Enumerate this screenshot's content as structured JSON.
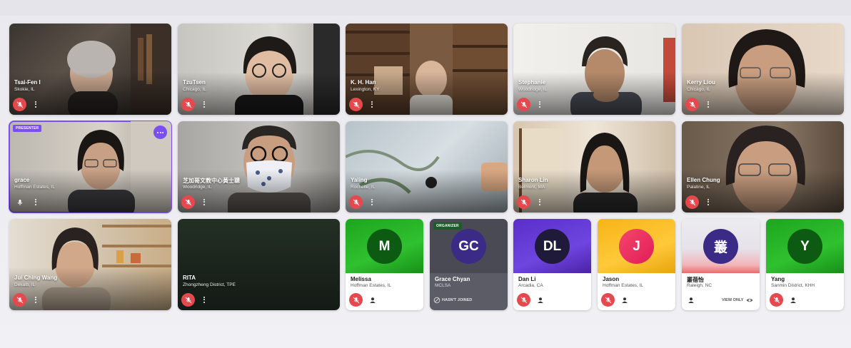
{
  "meeting": {
    "participants": [
      {
        "name": "Tsai-Fen I",
        "location": "Skokie, IL",
        "muted": true
      },
      {
        "name": "TzuTsen",
        "location": "Chicago, IL",
        "muted": true
      },
      {
        "name": "K. H. Han",
        "location": "Lexington, KY",
        "muted": true
      },
      {
        "name": "Stephanie",
        "location": "Woodridge, IL",
        "muted": true
      },
      {
        "name": "Kerry Liou",
        "location": "Chicago, IL",
        "muted": true
      },
      {
        "name": "grace",
        "location": "Hoffman Estates, IL",
        "muted": false,
        "badge": "PRESENTER"
      },
      {
        "name": "芝加哥文教中心黃士聰",
        "location": "Woodridge, IL",
        "muted": true
      },
      {
        "name": "Yaling",
        "location": "Rochelle, IL",
        "muted": true
      },
      {
        "name": "Sharon Lin",
        "location": "Belmont, MA",
        "muted": true
      },
      {
        "name": "Ellen Chung",
        "location": "Palatine, IL",
        "muted": true
      },
      {
        "name": "Jui Ching Wang",
        "location": "Dekalb, IL",
        "muted": true
      },
      {
        "name": "RITA",
        "location": "Zhongzheng District, TPE",
        "muted": true
      },
      {
        "name": "Melissa",
        "location": "Hoffman Estates, IL",
        "initials": "M",
        "muted": true
      },
      {
        "name": "Grace Chyan",
        "location": "MCLSA",
        "initials": "GC",
        "badge": "ORGANIZER",
        "status": "HASN'T JOINED"
      },
      {
        "name": "Dan Li",
        "location": "Arcadia, CA",
        "initials": "DL",
        "muted": true
      },
      {
        "name": "Jason",
        "location": "Hoffman Estates, IL",
        "initials": "J",
        "muted": true
      },
      {
        "name": "叢蓓怡",
        "location": "Raleigh, NC",
        "initials": "叢",
        "status": "VIEW ONLY"
      },
      {
        "name": "Yang",
        "location": "Sanmin District, KHH",
        "initials": "Y",
        "muted": true
      }
    ]
  },
  "colors": {
    "mute_red": "#e5484d",
    "presenter_purple": "#7a4ef0",
    "organizer_green": "#1e5a2a"
  },
  "icons": [
    "mic-off-icon",
    "mic-icon",
    "more-options-icon",
    "person-icon",
    "eye-icon",
    "not-joined-icon"
  ]
}
